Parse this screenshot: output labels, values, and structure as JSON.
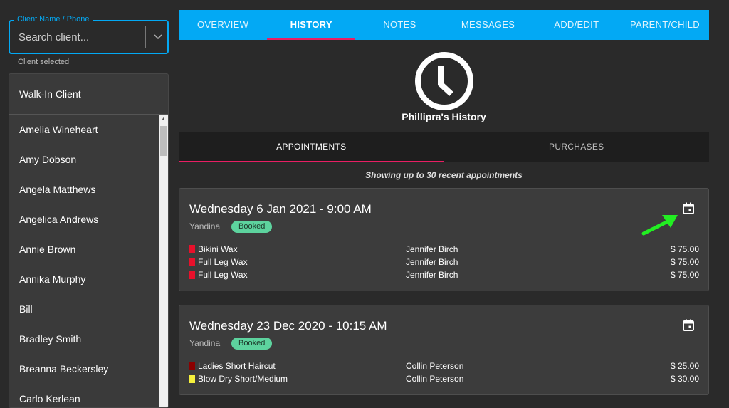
{
  "search": {
    "legend": "Client Name / Phone",
    "placeholder": "Search client...",
    "hint": "Client selected"
  },
  "clients": {
    "walk_in": "Walk-In Client",
    "items": [
      "Amelia Wineheart",
      "Amy Dobson",
      "Angela Matthews",
      "Angelica Andrews",
      "Annie Brown",
      "Annika Murphy",
      "Bill",
      "Bradley Smith",
      "Breanna Beckersley",
      "Carlo Kerlean"
    ]
  },
  "tabs": [
    {
      "label": "OVERVIEW"
    },
    {
      "label": "HISTORY"
    },
    {
      "label": "NOTES"
    },
    {
      "label": "MESSAGES"
    },
    {
      "label": "ADD/EDIT"
    },
    {
      "label": "PARENT/CHILD"
    }
  ],
  "history": {
    "title": "Phillipra's History",
    "icon": "clock-icon",
    "subtabs": [
      {
        "label": "APPOINTMENTS"
      },
      {
        "label": "PURCHASES"
      }
    ],
    "showing": "Showing up to 30 recent appointments"
  },
  "appointments": [
    {
      "date": "Wednesday 6 Jan 2021 - 9:00 AM",
      "location": "Yandina",
      "status": "Booked",
      "services": [
        {
          "name": "Bikini Wax",
          "staff": "Jennifer Birch",
          "price": "$ 75.00",
          "color": "#e8102b"
        },
        {
          "name": "Full Leg Wax",
          "staff": "Jennifer Birch",
          "price": "$ 75.00",
          "color": "#e8102b"
        },
        {
          "name": "Full Leg Wax",
          "staff": "Jennifer Birch",
          "price": "$ 75.00",
          "color": "#e8102b"
        }
      ]
    },
    {
      "date": "Wednesday 23 Dec 2020 - 10:15 AM",
      "location": "Yandina",
      "status": "Booked",
      "services": [
        {
          "name": "Ladies Short Haircut",
          "staff": "Collin Peterson",
          "price": "$ 25.00",
          "color": "#8b0000"
        },
        {
          "name": "Blow Dry Short/Medium",
          "staff": "Collin Peterson",
          "price": "$ 30.00",
          "color": "#f5f03c"
        }
      ]
    }
  ],
  "colors": {
    "accent": "#03a9f4",
    "tab_indicator": "#e91e63",
    "badge": "#5dd39e",
    "arrow": "#22ee22"
  }
}
